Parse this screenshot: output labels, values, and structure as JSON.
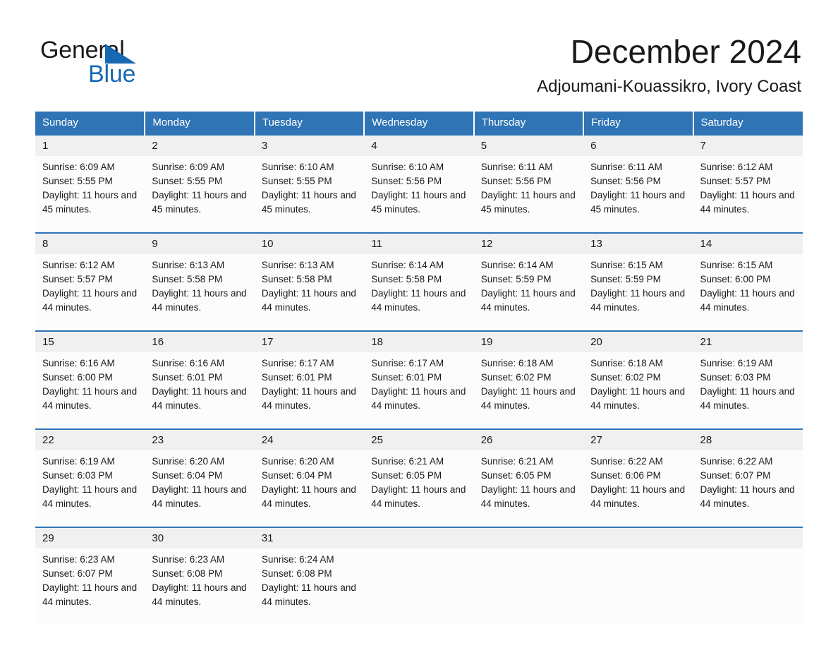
{
  "brand": {
    "name_part1": "General",
    "name_part2": "Blue",
    "triangle_color": "#1668b3"
  },
  "header": {
    "month_title": "December 2024",
    "location": "Adjoumani-Kouassikro, Ivory Coast"
  },
  "colors": {
    "header_blue": "#2f74b5",
    "daynum_band": "#f0f0f0",
    "cell_background": "#fcfcfc",
    "text": "#1a1a1a"
  },
  "weekday_headers": [
    "Sunday",
    "Monday",
    "Tuesday",
    "Wednesday",
    "Thursday",
    "Friday",
    "Saturday"
  ],
  "labels": {
    "sunrise_prefix": "Sunrise: ",
    "sunset_prefix": "Sunset: ",
    "daylight_prefix": "Daylight: "
  },
  "weeks": [
    {
      "days": [
        {
          "date": "1",
          "sunrise": "Sunrise: 6:09 AM",
          "sunset": "Sunset: 5:55 PM",
          "daylight": "Daylight: 11 hours and 45 minutes."
        },
        {
          "date": "2",
          "sunrise": "Sunrise: 6:09 AM",
          "sunset": "Sunset: 5:55 PM",
          "daylight": "Daylight: 11 hours and 45 minutes."
        },
        {
          "date": "3",
          "sunrise": "Sunrise: 6:10 AM",
          "sunset": "Sunset: 5:55 PM",
          "daylight": "Daylight: 11 hours and 45 minutes."
        },
        {
          "date": "4",
          "sunrise": "Sunrise: 6:10 AM",
          "sunset": "Sunset: 5:56 PM",
          "daylight": "Daylight: 11 hours and 45 minutes."
        },
        {
          "date": "5",
          "sunrise": "Sunrise: 6:11 AM",
          "sunset": "Sunset: 5:56 PM",
          "daylight": "Daylight: 11 hours and 45 minutes."
        },
        {
          "date": "6",
          "sunrise": "Sunrise: 6:11 AM",
          "sunset": "Sunset: 5:56 PM",
          "daylight": "Daylight: 11 hours and 45 minutes."
        },
        {
          "date": "7",
          "sunrise": "Sunrise: 6:12 AM",
          "sunset": "Sunset: 5:57 PM",
          "daylight": "Daylight: 11 hours and 44 minutes."
        }
      ]
    },
    {
      "days": [
        {
          "date": "8",
          "sunrise": "Sunrise: 6:12 AM",
          "sunset": "Sunset: 5:57 PM",
          "daylight": "Daylight: 11 hours and 44 minutes."
        },
        {
          "date": "9",
          "sunrise": "Sunrise: 6:13 AM",
          "sunset": "Sunset: 5:58 PM",
          "daylight": "Daylight: 11 hours and 44 minutes."
        },
        {
          "date": "10",
          "sunrise": "Sunrise: 6:13 AM",
          "sunset": "Sunset: 5:58 PM",
          "daylight": "Daylight: 11 hours and 44 minutes."
        },
        {
          "date": "11",
          "sunrise": "Sunrise: 6:14 AM",
          "sunset": "Sunset: 5:58 PM",
          "daylight": "Daylight: 11 hours and 44 minutes."
        },
        {
          "date": "12",
          "sunrise": "Sunrise: 6:14 AM",
          "sunset": "Sunset: 5:59 PM",
          "daylight": "Daylight: 11 hours and 44 minutes."
        },
        {
          "date": "13",
          "sunrise": "Sunrise: 6:15 AM",
          "sunset": "Sunset: 5:59 PM",
          "daylight": "Daylight: 11 hours and 44 minutes."
        },
        {
          "date": "14",
          "sunrise": "Sunrise: 6:15 AM",
          "sunset": "Sunset: 6:00 PM",
          "daylight": "Daylight: 11 hours and 44 minutes."
        }
      ]
    },
    {
      "days": [
        {
          "date": "15",
          "sunrise": "Sunrise: 6:16 AM",
          "sunset": "Sunset: 6:00 PM",
          "daylight": "Daylight: 11 hours and 44 minutes."
        },
        {
          "date": "16",
          "sunrise": "Sunrise: 6:16 AM",
          "sunset": "Sunset: 6:01 PM",
          "daylight": "Daylight: 11 hours and 44 minutes."
        },
        {
          "date": "17",
          "sunrise": "Sunrise: 6:17 AM",
          "sunset": "Sunset: 6:01 PM",
          "daylight": "Daylight: 11 hours and 44 minutes."
        },
        {
          "date": "18",
          "sunrise": "Sunrise: 6:17 AM",
          "sunset": "Sunset: 6:01 PM",
          "daylight": "Daylight: 11 hours and 44 minutes."
        },
        {
          "date": "19",
          "sunrise": "Sunrise: 6:18 AM",
          "sunset": "Sunset: 6:02 PM",
          "daylight": "Daylight: 11 hours and 44 minutes."
        },
        {
          "date": "20",
          "sunrise": "Sunrise: 6:18 AM",
          "sunset": "Sunset: 6:02 PM",
          "daylight": "Daylight: 11 hours and 44 minutes."
        },
        {
          "date": "21",
          "sunrise": "Sunrise: 6:19 AM",
          "sunset": "Sunset: 6:03 PM",
          "daylight": "Daylight: 11 hours and 44 minutes."
        }
      ]
    },
    {
      "days": [
        {
          "date": "22",
          "sunrise": "Sunrise: 6:19 AM",
          "sunset": "Sunset: 6:03 PM",
          "daylight": "Daylight: 11 hours and 44 minutes."
        },
        {
          "date": "23",
          "sunrise": "Sunrise: 6:20 AM",
          "sunset": "Sunset: 6:04 PM",
          "daylight": "Daylight: 11 hours and 44 minutes."
        },
        {
          "date": "24",
          "sunrise": "Sunrise: 6:20 AM",
          "sunset": "Sunset: 6:04 PM",
          "daylight": "Daylight: 11 hours and 44 minutes."
        },
        {
          "date": "25",
          "sunrise": "Sunrise: 6:21 AM",
          "sunset": "Sunset: 6:05 PM",
          "daylight": "Daylight: 11 hours and 44 minutes."
        },
        {
          "date": "26",
          "sunrise": "Sunrise: 6:21 AM",
          "sunset": "Sunset: 6:05 PM",
          "daylight": "Daylight: 11 hours and 44 minutes."
        },
        {
          "date": "27",
          "sunrise": "Sunrise: 6:22 AM",
          "sunset": "Sunset: 6:06 PM",
          "daylight": "Daylight: 11 hours and 44 minutes."
        },
        {
          "date": "28",
          "sunrise": "Sunrise: 6:22 AM",
          "sunset": "Sunset: 6:07 PM",
          "daylight": "Daylight: 11 hours and 44 minutes."
        }
      ]
    },
    {
      "days": [
        {
          "date": "29",
          "sunrise": "Sunrise: 6:23 AM",
          "sunset": "Sunset: 6:07 PM",
          "daylight": "Daylight: 11 hours and 44 minutes."
        },
        {
          "date": "30",
          "sunrise": "Sunrise: 6:23 AM",
          "sunset": "Sunset: 6:08 PM",
          "daylight": "Daylight: 11 hours and 44 minutes."
        },
        {
          "date": "31",
          "sunrise": "Sunrise: 6:24 AM",
          "sunset": "Sunset: 6:08 PM",
          "daylight": "Daylight: 11 hours and 44 minutes."
        },
        {
          "date": "",
          "sunrise": "",
          "sunset": "",
          "daylight": ""
        },
        {
          "date": "",
          "sunrise": "",
          "sunset": "",
          "daylight": ""
        },
        {
          "date": "",
          "sunrise": "",
          "sunset": "",
          "daylight": ""
        },
        {
          "date": "",
          "sunrise": "",
          "sunset": "",
          "daylight": ""
        }
      ]
    }
  ]
}
